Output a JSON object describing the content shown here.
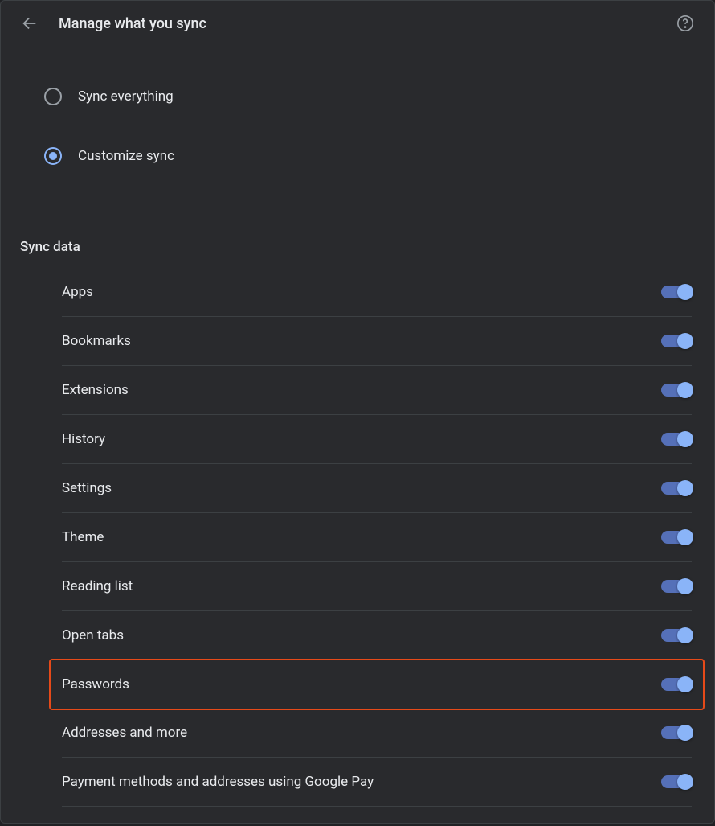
{
  "header": {
    "title": "Manage what you sync"
  },
  "radios": {
    "sync_everything": {
      "label": "Sync everything",
      "selected": false
    },
    "customize_sync": {
      "label": "Customize sync",
      "selected": true
    }
  },
  "section_title": "Sync data",
  "items": [
    {
      "key": "apps",
      "label": "Apps",
      "on": true,
      "highlighted": false
    },
    {
      "key": "bookmarks",
      "label": "Bookmarks",
      "on": true,
      "highlighted": false
    },
    {
      "key": "extensions",
      "label": "Extensions",
      "on": true,
      "highlighted": false
    },
    {
      "key": "history",
      "label": "History",
      "on": true,
      "highlighted": false
    },
    {
      "key": "settings",
      "label": "Settings",
      "on": true,
      "highlighted": false
    },
    {
      "key": "theme",
      "label": "Theme",
      "on": true,
      "highlighted": false
    },
    {
      "key": "reading",
      "label": "Reading list",
      "on": true,
      "highlighted": false
    },
    {
      "key": "open_tabs",
      "label": "Open tabs",
      "on": true,
      "highlighted": false
    },
    {
      "key": "passwords",
      "label": "Passwords",
      "on": true,
      "highlighted": true
    },
    {
      "key": "addresses",
      "label": "Addresses and more",
      "on": true,
      "highlighted": false
    },
    {
      "key": "payment",
      "label": "Payment methods and addresses using Google Pay",
      "on": true,
      "highlighted": false
    }
  ],
  "colors": {
    "accent": "#8ab4f8",
    "highlight_border": "#e64a19"
  }
}
